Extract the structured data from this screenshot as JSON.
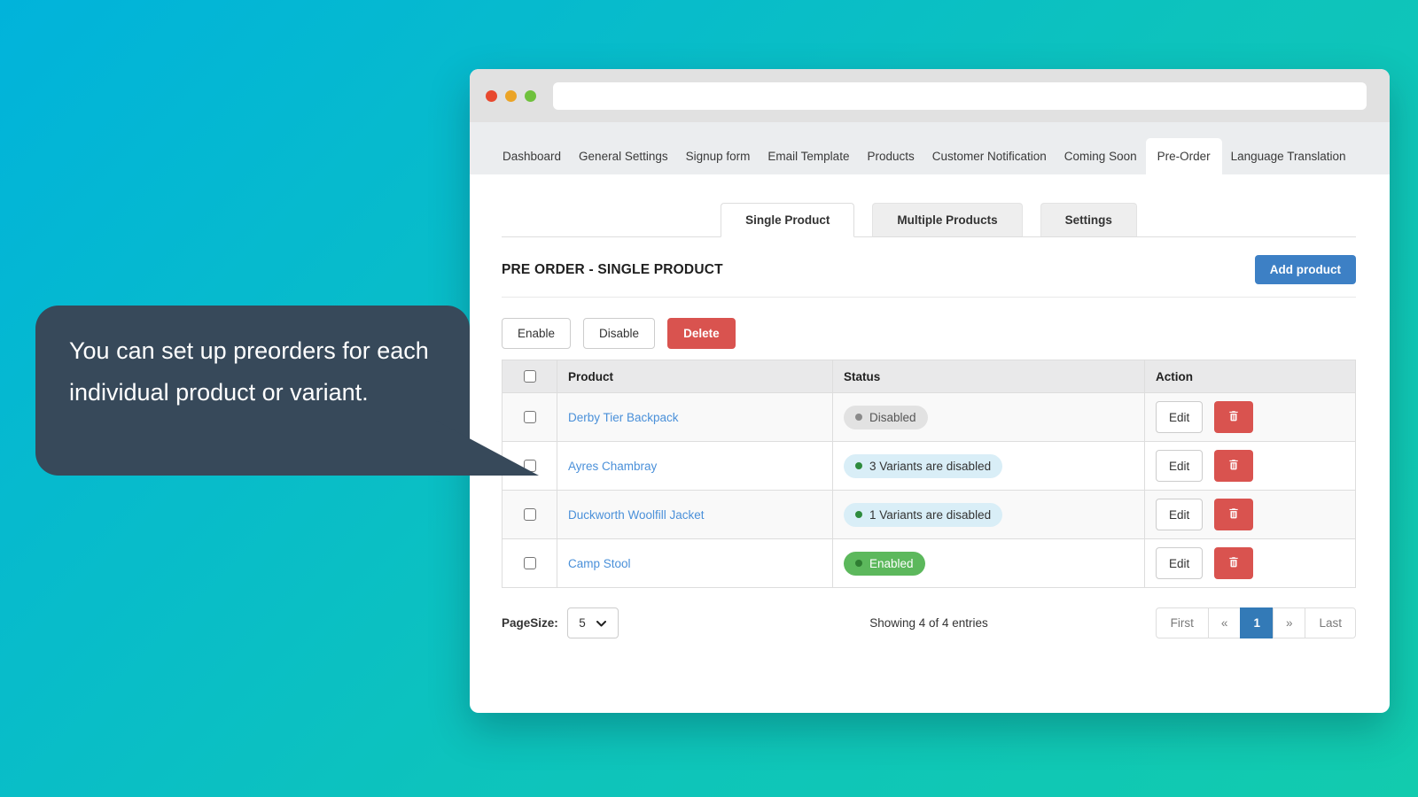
{
  "tooltip": {
    "text": "You can set up preorders for each individual product or variant."
  },
  "nav": {
    "tabs": [
      {
        "label": "Dashboard",
        "active": false
      },
      {
        "label": "General Settings",
        "active": false
      },
      {
        "label": "Signup form",
        "active": false
      },
      {
        "label": "Email Template",
        "active": false
      },
      {
        "label": "Products",
        "active": false
      },
      {
        "label": "Customer Notification",
        "active": false
      },
      {
        "label": "Coming Soon",
        "active": false
      },
      {
        "label": "Pre-Order",
        "active": true
      },
      {
        "label": "Language Translation",
        "active": false
      }
    ]
  },
  "subtabs": [
    {
      "label": "Single Product",
      "active": true
    },
    {
      "label": "Multiple Products",
      "active": false
    },
    {
      "label": "Settings",
      "active": false
    }
  ],
  "page": {
    "title": "PRE ORDER - SINGLE PRODUCT",
    "add_product_label": "Add product"
  },
  "bulk_actions": {
    "enable_label": "Enable",
    "disable_label": "Disable",
    "delete_label": "Delete"
  },
  "table": {
    "columns": {
      "product": "Product",
      "status": "Status",
      "action": "Action"
    },
    "edit_label": "Edit",
    "rows": [
      {
        "product": "Derby Tier Backpack",
        "status": "Disabled",
        "status_type": "disabled"
      },
      {
        "product": "Ayres Chambray",
        "status": "3 Variants are disabled",
        "status_type": "info"
      },
      {
        "product": "Duckworth Woolfill Jacket",
        "status": "1 Variants are disabled",
        "status_type": "info"
      },
      {
        "product": "Camp Stool",
        "status": "Enabled",
        "status_type": "enabled"
      }
    ]
  },
  "footer": {
    "pagesize_label": "PageSize:",
    "pagesize_value": "5",
    "showing_text": "Showing 4 of 4 entries",
    "pagination": {
      "first": "First",
      "prev": "«",
      "page": "1",
      "next": "»",
      "last": "Last"
    }
  },
  "colors": {
    "background_gradient_start": "#01b3db",
    "background_gradient_end": "#12cbae",
    "tooltip_background": "#37495a",
    "accent_blue": "#3d80c5",
    "active_page_blue": "#337ab7",
    "danger_red": "#d9534f",
    "success_green": "#5cb85c",
    "info_pill_background": "#d9eef7",
    "disabled_pill_background": "#e2e2e2",
    "traffic_red": "#e8492f",
    "traffic_orange": "#eba426",
    "traffic_green": "#6fc13d"
  }
}
